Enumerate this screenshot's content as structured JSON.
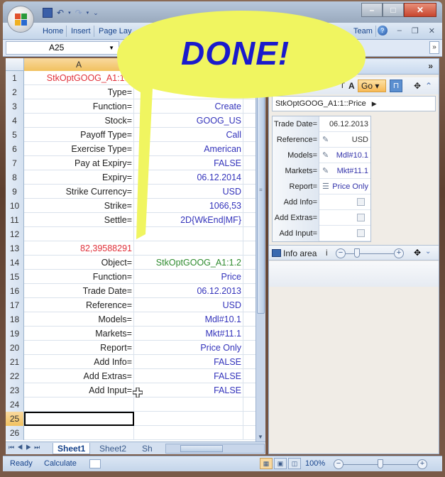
{
  "window": {
    "quick_access": [
      "save-icon",
      "undo-icon",
      "redo-icon",
      "customize-icon"
    ],
    "buttons": {
      "minimize": "–",
      "maximize": "□",
      "close": "✕"
    }
  },
  "ribbon": {
    "tabs": [
      "Home",
      "Insert",
      "Page Lay",
      "Team"
    ],
    "help_label": "?",
    "mdi": {
      "minimize": "–",
      "restore": "❐",
      "close": "✕"
    }
  },
  "formula_bar": {
    "name_box": "A25",
    "expand_icon": "»"
  },
  "sheet": {
    "columns": [
      "A"
    ],
    "rows": [
      {
        "n": "1",
        "a": "StkOptGOOG_A1:1.2",
        "b": "",
        "a_style": "red"
      },
      {
        "n": "2",
        "a": "Type=",
        "b": ""
      },
      {
        "n": "3",
        "a": "Function=",
        "b": "Create"
      },
      {
        "n": "4",
        "a": "Stock=",
        "b": "GOOG_US"
      },
      {
        "n": "5",
        "a": "Payoff Type=",
        "b": "Call"
      },
      {
        "n": "6",
        "a": "Exercise Type=",
        "b": "American"
      },
      {
        "n": "7",
        "a": "Pay at Expiry=",
        "b": "FALSE"
      },
      {
        "n": "8",
        "a": "Expiry=",
        "b": "06.12.2014"
      },
      {
        "n": "9",
        "a": "Strike Currency=",
        "b": "USD"
      },
      {
        "n": "10",
        "a": "Strike=",
        "b": "1066,53"
      },
      {
        "n": "11",
        "a": "Settle=",
        "b": "2D{WkEnd|MF}"
      },
      {
        "n": "12",
        "a": "",
        "b": ""
      },
      {
        "n": "13",
        "a": "82,39588291",
        "b": "",
        "a_style": "red"
      },
      {
        "n": "14",
        "a": "Object=",
        "b": "StkOptGOOG_A1:1.2",
        "b_style": "green"
      },
      {
        "n": "15",
        "a": "Function=",
        "b": "Price"
      },
      {
        "n": "16",
        "a": "Trade Date=",
        "b": "06.12.2013"
      },
      {
        "n": "17",
        "a": "Reference=",
        "b": "USD"
      },
      {
        "n": "18",
        "a": "Models=",
        "b": "Mdl#10.1"
      },
      {
        "n": "19",
        "a": "Markets=",
        "b": "Mkt#11.1"
      },
      {
        "n": "20",
        "a": "Report=",
        "b": "Price Only"
      },
      {
        "n": "21",
        "a": "Add Info=",
        "b": "FALSE"
      },
      {
        "n": "22",
        "a": "Add Extras=",
        "b": "FALSE"
      },
      {
        "n": "23",
        "a": "Add Input=",
        "b": "FALSE"
      },
      {
        "n": "24",
        "a": "",
        "b": ""
      },
      {
        "n": "25",
        "a": "",
        "b": "",
        "selected": true
      },
      {
        "n": "26",
        "a": "",
        "b": ""
      }
    ],
    "tabs": [
      "Sheet1",
      "Sheet2",
      "Sh"
    ],
    "active_tab": "Sheet1"
  },
  "status_bar": {
    "ready": "Ready",
    "calculate": "Calculate",
    "zoom": "100%",
    "zoom_fraction": 0.5
  },
  "task_pane": {
    "collapse_label": "»",
    "toolbar": {
      "font_t": "T",
      "font_a": "A",
      "go_label": "Go ▾",
      "lock_icon": "🔓",
      "move_icon": "✥",
      "up_icon": "⌃"
    },
    "object_path": "StkOptGOOG_A1:1::Price",
    "properties": [
      {
        "label": "Trade Date=",
        "value": "06.12.2013",
        "icon": "",
        "type": "text"
      },
      {
        "label": "Reference=",
        "value": "USD",
        "icon": "edit-icon",
        "type": "text"
      },
      {
        "label": "Models=",
        "value": "Mdl#10.1",
        "icon": "edit-icon",
        "type": "link"
      },
      {
        "label": "Markets=",
        "value": "Mkt#11.1",
        "icon": "edit-icon",
        "type": "link"
      },
      {
        "label": "Report=",
        "value": "Price Only",
        "icon": "list-icon",
        "type": "link"
      },
      {
        "label": "Add Info=",
        "value": "",
        "icon": "",
        "type": "checkbox",
        "checked": false
      },
      {
        "label": "Add Extras=",
        "value": "",
        "icon": "",
        "type": "checkbox",
        "checked": false
      },
      {
        "label": "Add Input=",
        "value": "",
        "icon": "",
        "type": "checkbox",
        "checked": false
      }
    ],
    "info_area": {
      "label": "Info area",
      "info_glyph": "i",
      "zoom_fraction": 0.2
    }
  },
  "overlay": {
    "text": "DONE!",
    "color": "#1a1acc",
    "balloon_color": "#f0f560"
  }
}
